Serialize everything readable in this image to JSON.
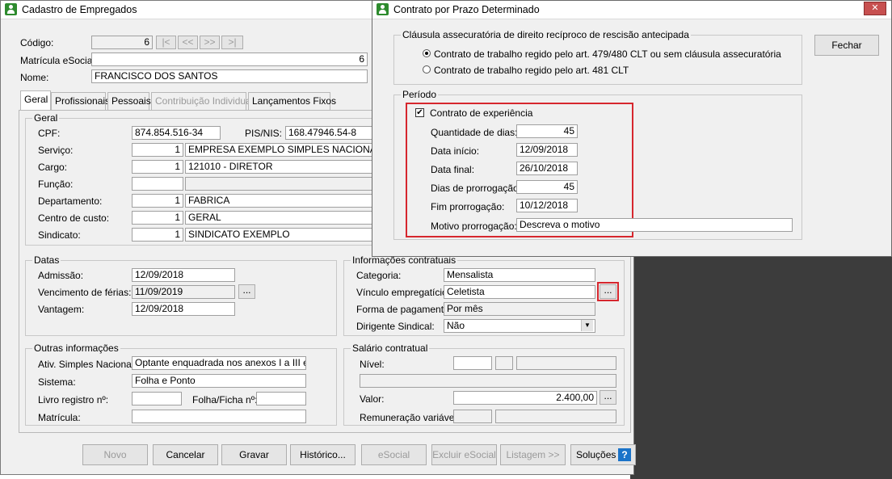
{
  "main_window": {
    "title": "Cadastro de Empregados",
    "codigo_label": "Código:",
    "codigo_value": "6",
    "nav_first": "|<",
    "nav_prev": "<<",
    "nav_next": ">>",
    "nav_last": ">|",
    "matricula_esocial_label": "Matrícula eSocial:",
    "matricula_esocial_value": "6",
    "nome_label": "Nome:",
    "nome_value": "FRANCISCO DOS SANTOS",
    "tabs": [
      {
        "label": "Geral"
      },
      {
        "label": "Profissionais"
      },
      {
        "label": "Pessoais"
      },
      {
        "label": "Contribuição Individual"
      },
      {
        "label": "Lançamentos Fixos"
      }
    ],
    "geral": {
      "title": "Geral",
      "cpf_label": "CPF:",
      "cpf_value": "874.854.516-34",
      "pis_label": "PIS/NIS:",
      "pis_value": "168.47946.54-8",
      "servico_label": "Serviço:",
      "servico_code": "1",
      "servico_name": "EMPRESA EXEMPLO SIMPLES NACIONAL LTI",
      "cargo_label": "Cargo:",
      "cargo_code": "1",
      "cargo_name": "121010 - DIRETOR",
      "funcao_label": "Função:",
      "departamento_label": "Departamento:",
      "departamento_code": "1",
      "departamento_name": "FABRICA",
      "centro_label": "Centro de custo:",
      "centro_code": "1",
      "centro_name": "GERAL",
      "sindicato_label": "Sindicato:",
      "sindicato_code": "1",
      "sindicato_name": "SINDICATO EXEMPLO"
    },
    "datas": {
      "title": "Datas",
      "admissao_label": "Admissão:",
      "admissao_value": "12/09/2018",
      "vencimento_label": "Vencimento de férias:",
      "vencimento_value": "11/09/2019",
      "vantagem_label": "Vantagem:",
      "vantagem_value": "12/09/2018",
      "ellipsis": "..."
    },
    "info_contratuais": {
      "title": "Informações contratuais",
      "categoria_label": "Categoria:",
      "categoria_value": "Mensalista",
      "vinculo_label": "Vínculo empregatício:",
      "vinculo_value": "Celetista",
      "forma_label": "Forma de pagamento:",
      "forma_value": "Por mês",
      "dirigente_label": "Dirigente Sindical:",
      "dirigente_value": "Não",
      "ellipsis": "..."
    },
    "outras": {
      "title": "Outras informações",
      "ativ_label": "Ativ. Simples Nacional:",
      "ativ_value": "Optante enquadrada nos anexos I a III e V a",
      "sistema_label": "Sistema:",
      "sistema_value": "Folha e Ponto",
      "livro_label": "Livro registro nº:",
      "folha_label": "Folha/Ficha nº:",
      "matricula_label": "Matrícula:"
    },
    "salario": {
      "title": "Salário contratual",
      "nivel_label": "Nível:",
      "valor_label": "Valor:",
      "valor_value": "2.400,00",
      "remuneracao_label": "Remuneração variável:",
      "ellipsis": "..."
    },
    "buttons": {
      "novo": "Novo",
      "cancelar": "Cancelar",
      "gravar": "Gravar",
      "historico": "Histórico...",
      "esocial": "eSocial",
      "excluir_esocial": "Excluir eSocial",
      "listagem": "Listagem >>",
      "solucoes": "Soluções",
      "help_glyph": "?"
    }
  },
  "dialog": {
    "title": "Contrato por Prazo Determinado",
    "close_glyph": "✕",
    "clausula_title": "Cláusula assecuratória de direito recíproco de rescisão antecipada",
    "option1": "Contrato de trabalho regido pelo art. 479/480 CLT ou sem cláusula assecuratória",
    "option2": "Contrato de trabalho regido pelo art. 481 CLT",
    "fechar": "Fechar",
    "periodo_title": "Período",
    "experiencia_label": "Contrato de experiência",
    "check_glyph": "✔",
    "quantidade_label": "Quantidade de dias:",
    "quantidade_value": "45",
    "inicio_label": "Data início:",
    "inicio_value": "12/09/2018",
    "final_label": "Data final:",
    "final_value": "26/10/2018",
    "dias_prorrogacao_label": "Dias de prorrogação:",
    "dias_prorrogacao_value": "45",
    "fim_prorrogacao_label": "Fim prorrogação:",
    "fim_prorrogacao_value": "10/12/2018",
    "motivo_label": "Motivo prorrogação:",
    "motivo_value": "Descreva o motivo"
  },
  "colors": {
    "highlight": "#d6272e",
    "close_button": "#c75050",
    "help_icon": "#1a73c9",
    "app_icon": "#2e8b2e",
    "backdrop": "#3c3c3c"
  }
}
